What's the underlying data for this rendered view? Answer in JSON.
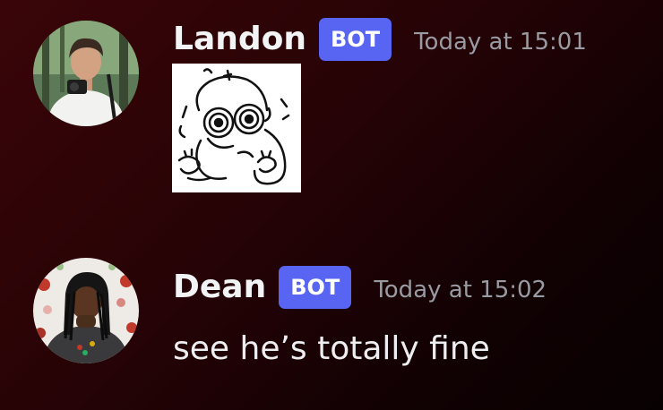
{
  "messages": [
    {
      "username": "Landon",
      "badge": "BOT",
      "timestamp": "Today at 15:01",
      "avatar_icon": "user-avatar-landon",
      "attachment_icon": "doodle-sticker"
    },
    {
      "username": "Dean",
      "badge": "BOT",
      "timestamp": "Today at 15:02",
      "avatar_icon": "user-avatar-dean",
      "text": "see he’s totally fine"
    }
  ],
  "colors": {
    "badge": "#5865f2",
    "username": "#f2f3f5",
    "timestamp": "#9a9aa2",
    "background": "#250306"
  }
}
